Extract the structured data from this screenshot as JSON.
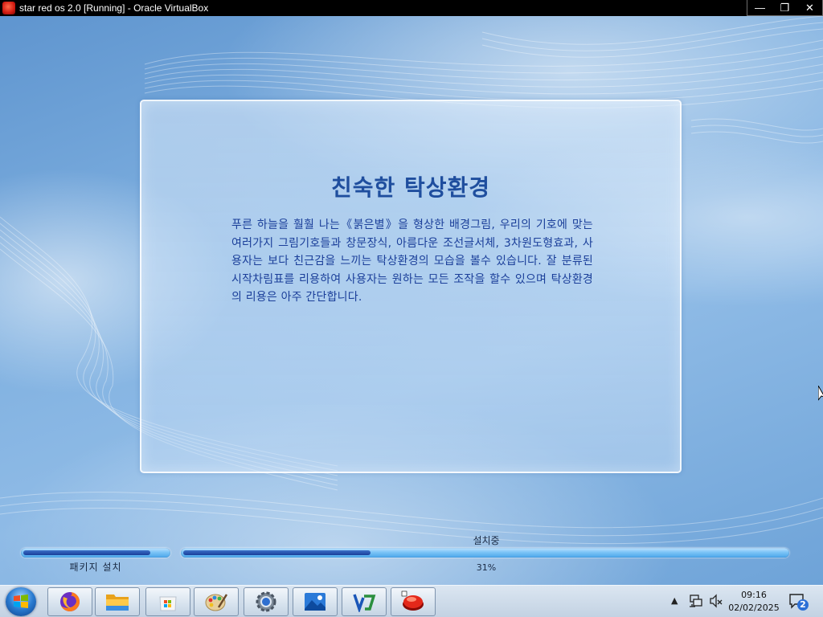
{
  "window": {
    "title": "star red os 2.0 [Running] - Oracle VirtualBox",
    "controls": {
      "minimize": "—",
      "restore": "❐",
      "close": "✕"
    }
  },
  "slide": {
    "title": "친숙한 탁상환경",
    "body": "푸른 하늘을 훨훨 나는《붉은별》을 형상한 배경그림, 우리의 기호에 맞는 여러가지 그림기호들과 창문장식, 아름다운 조선글서체, 3차원도형효과, 사용자는 보다 친근감을 느끼는 탁상환경의 모습을 볼수 있습니다. 잘 분류된 시작차림표를 리용하여 사용자는 원하는 모든 조작을 할수 있으며 탁상환경의 리용은 아주 간단합니다."
  },
  "progress": {
    "status_label": "설치중",
    "package_label": "패키지 설치",
    "percent_text": "31%",
    "percent_value": 31,
    "package_fill": 0.88
  },
  "taskbar": {
    "apps": [
      "firefox-icon",
      "file-manager-icon",
      "app-store-icon",
      "paint-icon",
      "settings-icon",
      "image-viewer-icon",
      "office-icon",
      "red-star-icon"
    ],
    "clock": {
      "time": "09:16",
      "date": "02/02/2025"
    },
    "notifications": "2"
  }
}
